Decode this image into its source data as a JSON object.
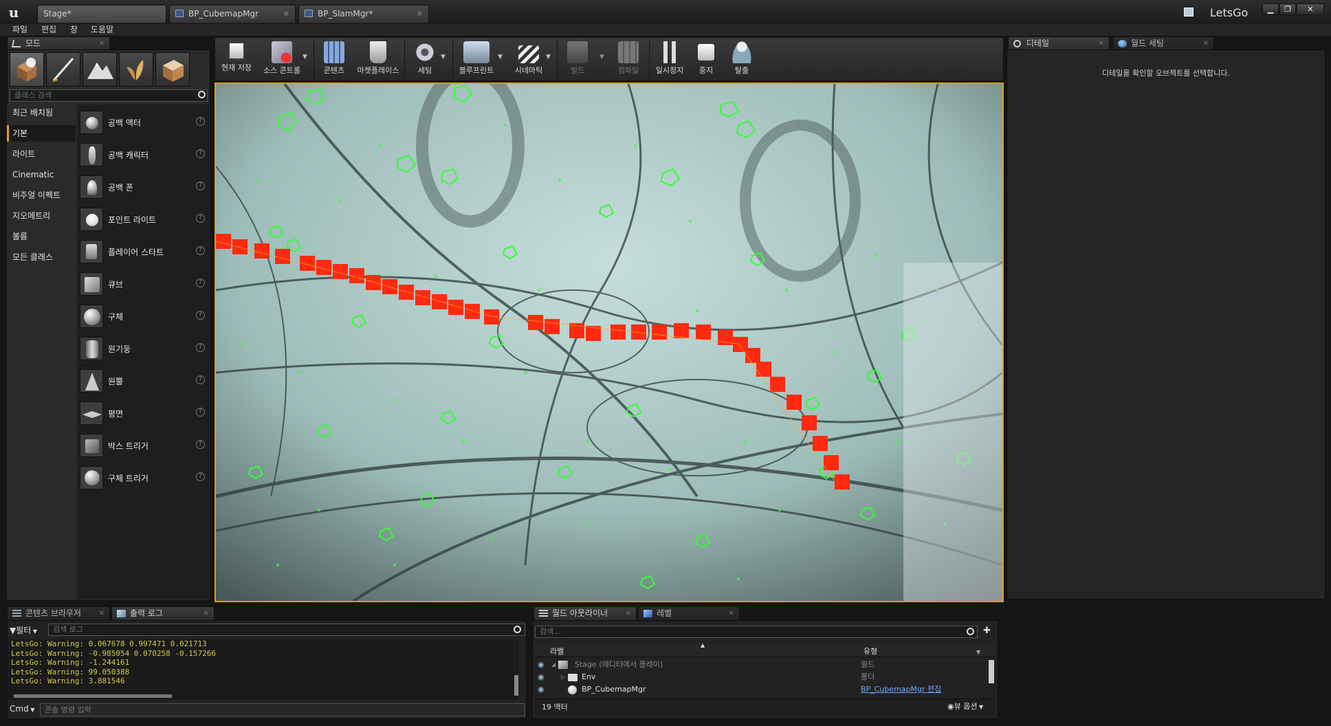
{
  "window": {
    "app_name": "LetsGo",
    "tabs": [
      {
        "label": "Stage*"
      },
      {
        "label": "BP_CubemapMgr"
      },
      {
        "label": "BP_SlamMgr*"
      }
    ]
  },
  "menu": [
    "파일",
    "편집",
    "창",
    "도움말"
  ],
  "modes": {
    "tab_label": "모드",
    "search_placeholder": "클래스 검색",
    "categories": [
      "최근 배치됨",
      "기본",
      "라이트",
      "Cinematic",
      "비주얼 이펙트",
      "지오메트리",
      "볼륨",
      "모든 클래스"
    ],
    "selected_category": "기본",
    "items": [
      "공백 액터",
      "공백 캐릭터",
      "공백 폰",
      "포인트 라이트",
      "플레이어 스타트",
      "큐브",
      "구체",
      "원기둥",
      "원뿔",
      "평면",
      "박스 트리거",
      "구체 트리거"
    ]
  },
  "toolbar": {
    "buttons": [
      {
        "label": "현재 저장",
        "icon": "save-icon"
      },
      {
        "label": "소스 콘트롤",
        "icon": "source-control-icon"
      },
      {
        "label": "콘텐츠",
        "icon": "content-icon"
      },
      {
        "label": "마켓플레이스",
        "icon": "marketplace-icon"
      },
      {
        "label": "세팅",
        "icon": "settings-icon"
      },
      {
        "label": "블루프린트",
        "icon": "blueprint-icon"
      },
      {
        "label": "시네마틱",
        "icon": "cinematic-icon"
      },
      {
        "label": "빌드",
        "icon": "build-icon"
      },
      {
        "label": "컴파일",
        "icon": "compile-icon"
      },
      {
        "label": "일시정지",
        "icon": "pause-icon"
      },
      {
        "label": "중지",
        "icon": "stop-icon"
      },
      {
        "label": "탈출",
        "icon": "eject-icon"
      }
    ]
  },
  "details": {
    "tabs": [
      "디테일",
      "월드 세팅"
    ],
    "empty_message": "디테일을 확인할 오브젝트를 선택합니다."
  },
  "bottom_left": {
    "tabs": [
      "콘텐츠 브라우저",
      "출력 로그"
    ],
    "filter_label": "필터",
    "search_placeholder": "검색 로그",
    "log_lines": [
      "LetsGo: Warning: 0.067678 0.997471 0.021713",
      "LetsGo: Warning: -0.985054 0.070258 -0.157266",
      "LetsGo: Warning: -1.244161",
      "LetsGo: Warning: 99.050388",
      "LetsGo: Warning: 3.881546"
    ],
    "cmd_label": "Cmd",
    "cmd_placeholder": "콘솔 명령 입력"
  },
  "outliner": {
    "tabs": [
      "월드 아웃라이너",
      "레벨"
    ],
    "search_placeholder": "검색...",
    "columns": [
      "라벨",
      "유형"
    ],
    "rows": [
      {
        "label": "Stage (에디터에서 플레이)",
        "type": "월드"
      },
      {
        "label": "Env",
        "type": "폴더"
      },
      {
        "label": "BP_CubemapMgr",
        "type": "BP_CubemapMgr 편집"
      }
    ],
    "actor_count": "19 액터",
    "view_options": "뷰 옵션"
  },
  "colors": {
    "viewport_border": "#d8a018",
    "feature_points": "#33ff33",
    "trajectory": "#ff2a10",
    "link": "#6aa8ff"
  }
}
